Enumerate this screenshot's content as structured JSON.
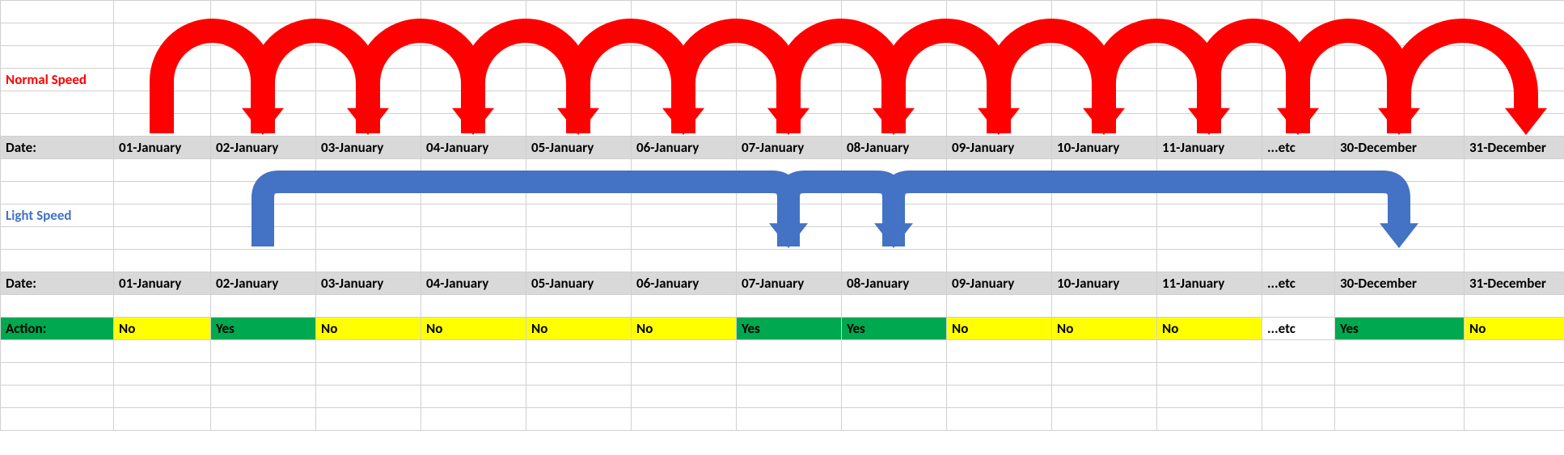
{
  "labels": {
    "normal_speed": "Normal Speed",
    "light_speed": "Light Speed",
    "date": "Date:",
    "action": "Action:"
  },
  "dates": [
    "01-January",
    "02-January",
    "03-January",
    "04-January",
    "05-January",
    "06-January",
    "07-January",
    "08-January",
    "09-January",
    "10-January",
    "11-January",
    "...etc",
    "30-December",
    "31-December"
  ],
  "actions": [
    {
      "v": "No",
      "c": "yellow"
    },
    {
      "v": "Yes",
      "c": "green"
    },
    {
      "v": "No",
      "c": "yellow"
    },
    {
      "v": "No",
      "c": "yellow"
    },
    {
      "v": "No",
      "c": "yellow"
    },
    {
      "v": "No",
      "c": "yellow"
    },
    {
      "v": "Yes",
      "c": "green"
    },
    {
      "v": "Yes",
      "c": "green"
    },
    {
      "v": "No",
      "c": "yellow"
    },
    {
      "v": "No",
      "c": "yellow"
    },
    {
      "v": "No",
      "c": "yellow"
    },
    {
      "v": "...etc",
      "c": ""
    },
    {
      "v": "Yes",
      "c": "green"
    },
    {
      "v": "No",
      "c": "yellow"
    }
  ],
  "colors": {
    "red": "#ff0000",
    "blue": "#4472c4"
  },
  "normal_arrows_count": 13,
  "light_arrows": [
    {
      "from_col": 1,
      "to_col": 6
    },
    {
      "from_col": 6,
      "to_col": 7
    },
    {
      "from_col": 7,
      "to_col": 12
    }
  ]
}
